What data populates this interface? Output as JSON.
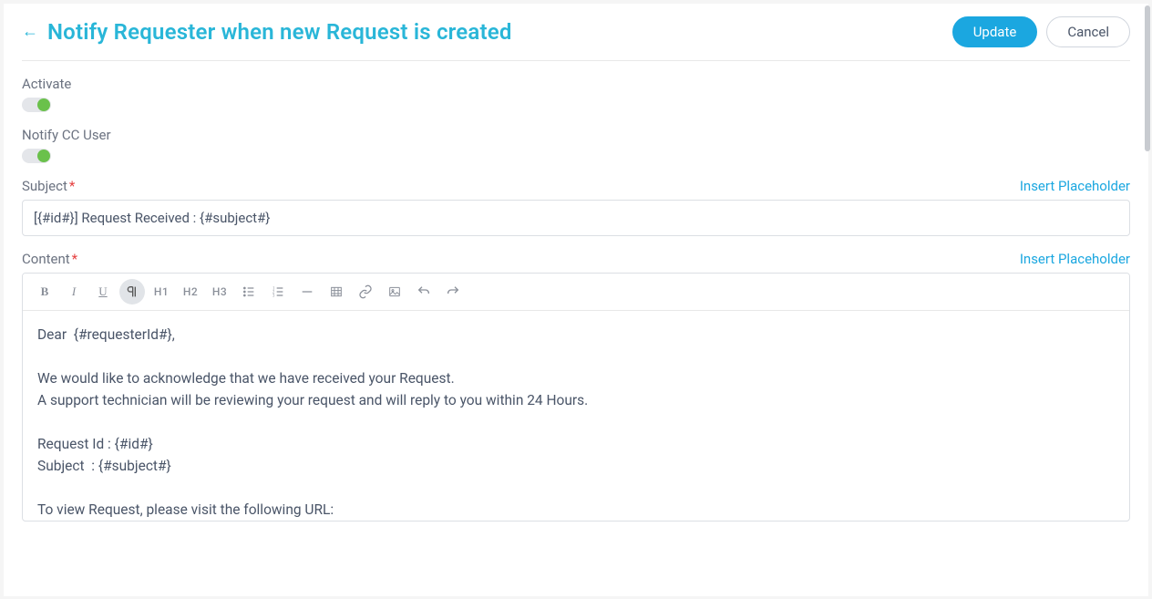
{
  "header": {
    "title": "Notify Requester when new Request is created",
    "update_label": "Update",
    "cancel_label": "Cancel"
  },
  "activate": {
    "label": "Activate",
    "on": true
  },
  "notify_cc": {
    "label": "Notify CC User",
    "on": true
  },
  "subject": {
    "label": "Subject",
    "value": "[{#id#}] Request Received : {#subject#}",
    "insert_link": "Insert Placeholder"
  },
  "content": {
    "label": "Content",
    "insert_link": "Insert Placeholder",
    "body": "Dear  {#requesterId#},\n\nWe would like to acknowledge that we have received your Request.\nA support technician will be reviewing your request and will reply to you within 24 Hours.\n\nRequest Id : {#id#}\nSubject  : {#subject#}\n\nTo view Request, please visit the following URL:"
  },
  "toolbar": {
    "h1": "H1",
    "h2": "H2",
    "h3": "H3"
  }
}
